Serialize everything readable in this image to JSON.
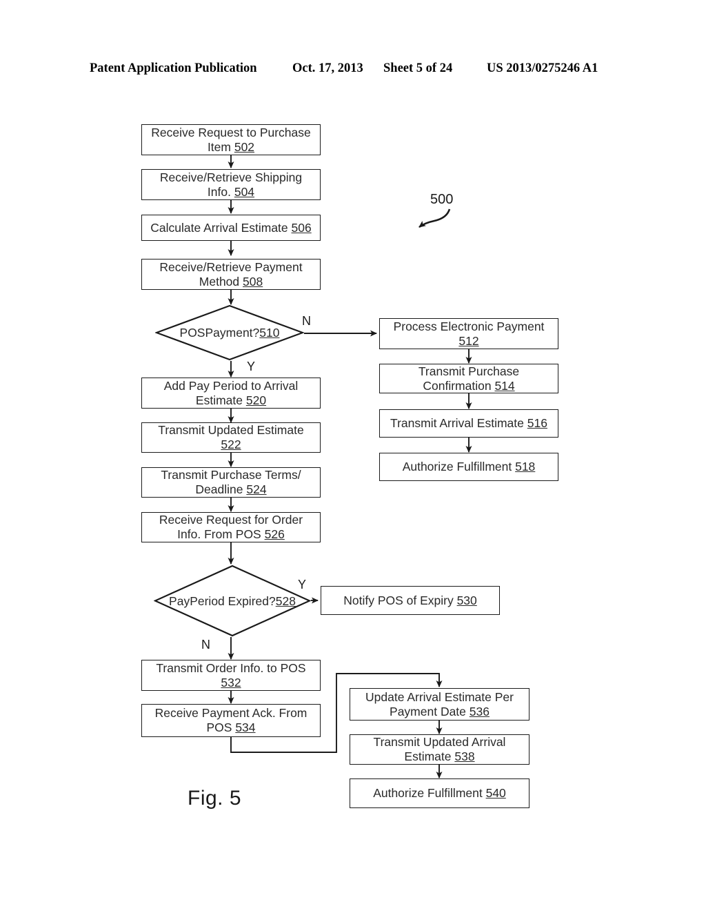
{
  "header": {
    "publication": "Patent Application Publication",
    "date": "Oct. 17, 2013",
    "sheet": "Sheet 5 of 24",
    "patent_number": "US 2013/0275246 A1"
  },
  "figure": {
    "caption": "Fig. 5",
    "diagram_reference": "500"
  },
  "chart_data": {
    "type": "diagram",
    "title": "Fig. 5",
    "diagram_reference": "500",
    "nodes": [
      {
        "id": "502",
        "shape": "process",
        "text": "Receive Request to Purchase\nItem ",
        "ref": "502"
      },
      {
        "id": "504",
        "shape": "process",
        "text": "Receive/Retrieve Shipping\nInfo. ",
        "ref": "504"
      },
      {
        "id": "506",
        "shape": "process",
        "text": "Calculate Arrival Estimate ",
        "ref": "506"
      },
      {
        "id": "508",
        "shape": "process",
        "text": "Receive/Retrieve Payment\nMethod ",
        "ref": "508"
      },
      {
        "id": "510",
        "shape": "decision",
        "text": "POS\nPayment?\n",
        "ref": "510"
      },
      {
        "id": "512",
        "shape": "process",
        "text": "Process Electronic Payment\n",
        "ref": "512"
      },
      {
        "id": "514",
        "shape": "process",
        "text": "Transmit Purchase\nConfirmation ",
        "ref": "514"
      },
      {
        "id": "516",
        "shape": "process",
        "text": "Transmit Arrival Estimate ",
        "ref": "516"
      },
      {
        "id": "518",
        "shape": "process",
        "text": "Authorize Fulfillment ",
        "ref": "518"
      },
      {
        "id": "520",
        "shape": "process",
        "text": "Add Pay Period to Arrival\nEstimate ",
        "ref": "520"
      },
      {
        "id": "522",
        "shape": "process",
        "text": "Transmit Updated Estimate\n",
        "ref": "522"
      },
      {
        "id": "524",
        "shape": "process",
        "text": "Transmit Purchase Terms/\nDeadline ",
        "ref": "524"
      },
      {
        "id": "526",
        "shape": "process",
        "text": "Receive Request for Order\nInfo. From POS ",
        "ref": "526"
      },
      {
        "id": "528",
        "shape": "decision",
        "text": "Pay\nPeriod Expired?\n",
        "ref": "528"
      },
      {
        "id": "530",
        "shape": "process",
        "text": "Notify POS of Expiry ",
        "ref": "530"
      },
      {
        "id": "532",
        "shape": "process",
        "text": "Transmit Order Info. to POS\n",
        "ref": "532"
      },
      {
        "id": "534",
        "shape": "process",
        "text": "Receive Payment Ack. From\nPOS ",
        "ref": "534"
      },
      {
        "id": "536",
        "shape": "process",
        "text": "Update Arrival Estimate Per\nPayment Date ",
        "ref": "536"
      },
      {
        "id": "538",
        "shape": "process",
        "text": "Transmit Updated Arrival\nEstimate ",
        "ref": "538"
      },
      {
        "id": "540",
        "shape": "process",
        "text": "Authorize Fulfillment ",
        "ref": "540"
      }
    ],
    "edges": [
      {
        "from": "502",
        "to": "504",
        "label": ""
      },
      {
        "from": "504",
        "to": "506",
        "label": ""
      },
      {
        "from": "506",
        "to": "508",
        "label": ""
      },
      {
        "from": "508",
        "to": "510",
        "label": ""
      },
      {
        "from": "510",
        "to": "512",
        "label": "N"
      },
      {
        "from": "510",
        "to": "520",
        "label": "Y"
      },
      {
        "from": "512",
        "to": "514",
        "label": ""
      },
      {
        "from": "514",
        "to": "516",
        "label": ""
      },
      {
        "from": "516",
        "to": "518",
        "label": ""
      },
      {
        "from": "520",
        "to": "522",
        "label": ""
      },
      {
        "from": "522",
        "to": "524",
        "label": ""
      },
      {
        "from": "524",
        "to": "526",
        "label": ""
      },
      {
        "from": "526",
        "to": "528",
        "label": ""
      },
      {
        "from": "528",
        "to": "530",
        "label": "Y"
      },
      {
        "from": "528",
        "to": "532",
        "label": "N"
      },
      {
        "from": "532",
        "to": "534",
        "label": ""
      },
      {
        "from": "534",
        "to": "536",
        "label": ""
      },
      {
        "from": "536",
        "to": "538",
        "label": ""
      },
      {
        "from": "538",
        "to": "540",
        "label": ""
      }
    ],
    "branch_labels": [
      "N",
      "Y",
      "Y",
      "N"
    ]
  },
  "branches": {
    "pos_payment_no": "N",
    "pos_payment_yes": "Y",
    "pay_period_yes": "Y",
    "pay_period_no": "N"
  },
  "nodes": {
    "n502": {
      "line1": "Receive Request to Purchase",
      "line2": "Item ",
      "ref": "502"
    },
    "n504": {
      "line1": "Receive/Retrieve Shipping",
      "line2": "Info. ",
      "ref": "504"
    },
    "n506": {
      "line1": "Calculate Arrival Estimate ",
      "line2": "",
      "ref": "506"
    },
    "n508": {
      "line1": "Receive/Retrieve Payment",
      "line2": "Method ",
      "ref": "508"
    },
    "n510": {
      "line1": "POS",
      "line2": "Payment?",
      "ref": "510"
    },
    "n512": {
      "line1": "Process Electronic Payment",
      "line2": "",
      "ref": "512"
    },
    "n514": {
      "line1": "Transmit Purchase",
      "line2": "Confirmation ",
      "ref": "514"
    },
    "n516": {
      "line1": "Transmit Arrival Estimate ",
      "line2": "",
      "ref": "516"
    },
    "n518": {
      "line1": "Authorize Fulfillment ",
      "line2": "",
      "ref": "518"
    },
    "n520": {
      "line1": "Add Pay Period to Arrival",
      "line2": "Estimate ",
      "ref": "520"
    },
    "n522": {
      "line1": "Transmit Updated Estimate",
      "line2": "",
      "ref": "522"
    },
    "n524": {
      "line1": "Transmit Purchase Terms/",
      "line2": "Deadline ",
      "ref": "524"
    },
    "n526": {
      "line1": "Receive Request for Order",
      "line2": "Info. From POS ",
      "ref": "526"
    },
    "n528": {
      "line1": "Pay",
      "line2": "Period Expired?",
      "ref": "528"
    },
    "n530": {
      "line1": "Notify POS of Expiry ",
      "line2": "",
      "ref": "530"
    },
    "n532": {
      "line1": "Transmit Order Info. to POS",
      "line2": "",
      "ref": "532"
    },
    "n534": {
      "line1": "Receive Payment Ack. From",
      "line2": "POS ",
      "ref": "534"
    },
    "n536": {
      "line1": "Update Arrival Estimate Per",
      "line2": "Payment Date ",
      "ref": "536"
    },
    "n538": {
      "line1": "Transmit Updated Arrival",
      "line2": "Estimate ",
      "ref": "538"
    },
    "n540": {
      "line1": "Authorize Fulfillment ",
      "line2": "",
      "ref": "540"
    }
  }
}
